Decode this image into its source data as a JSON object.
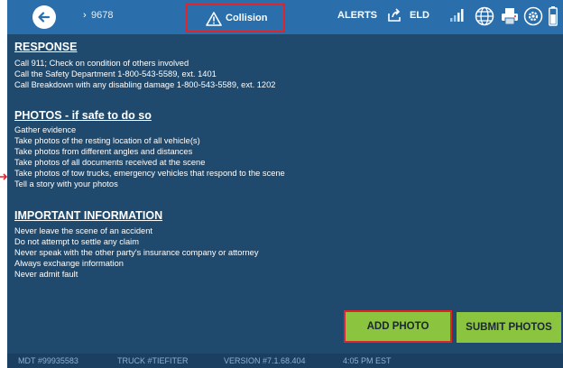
{
  "header": {
    "truck_chevron": "›",
    "truck_number": "9678",
    "collision_label": "Collision",
    "alerts_label": "ALERTS",
    "eld_label": "ELD"
  },
  "sections": [
    {
      "heading": "RESPONSE",
      "lines": [
        "Call 911; Check on condition of others involved",
        "Call the Safety Department 1-800-543-5589, ext. 1401",
        "Call Breakdown with any disabling damage 1-800-543-5589, ext. 1202"
      ]
    },
    {
      "heading": "PHOTOS - if safe to do so",
      "lines": [
        "Gather evidence",
        "Take photos of the resting location of all vehicle(s)",
        "Take photos from different angles and distances",
        "Take photos of all documents received at the scene",
        "Take photos of tow trucks, emergency vehicles that respond to the scene",
        "Tell a story with your photos"
      ]
    },
    {
      "heading": "IMPORTANT INFORMATION",
      "lines": [
        "Never leave the scene of an accident",
        "Do not attempt to settle any claim",
        "Never speak with the other party's insurance company or attorney",
        "Always exchange information",
        "Never admit fault"
      ]
    }
  ],
  "buttons": {
    "add_photo": "ADD PHOTO",
    "submit_photos": "SUBMIT PHOTOS"
  },
  "footer": {
    "mdt": "MDT #99935583",
    "truck": "TRUCK #TIEFITER",
    "version": "VERSION #7.1.68.404",
    "time": "4:05 PM EST"
  },
  "colors": {
    "background": "#1f4a6e",
    "topbar": "#2a6fab",
    "button_green": "#8bc43f",
    "highlight_red": "#e0242a"
  },
  "icons": [
    "back-arrow-icon",
    "warning-triangle-icon",
    "share-icon",
    "signal-icon",
    "globe-icon",
    "printer-icon",
    "gear-icon",
    "battery-icon"
  ]
}
